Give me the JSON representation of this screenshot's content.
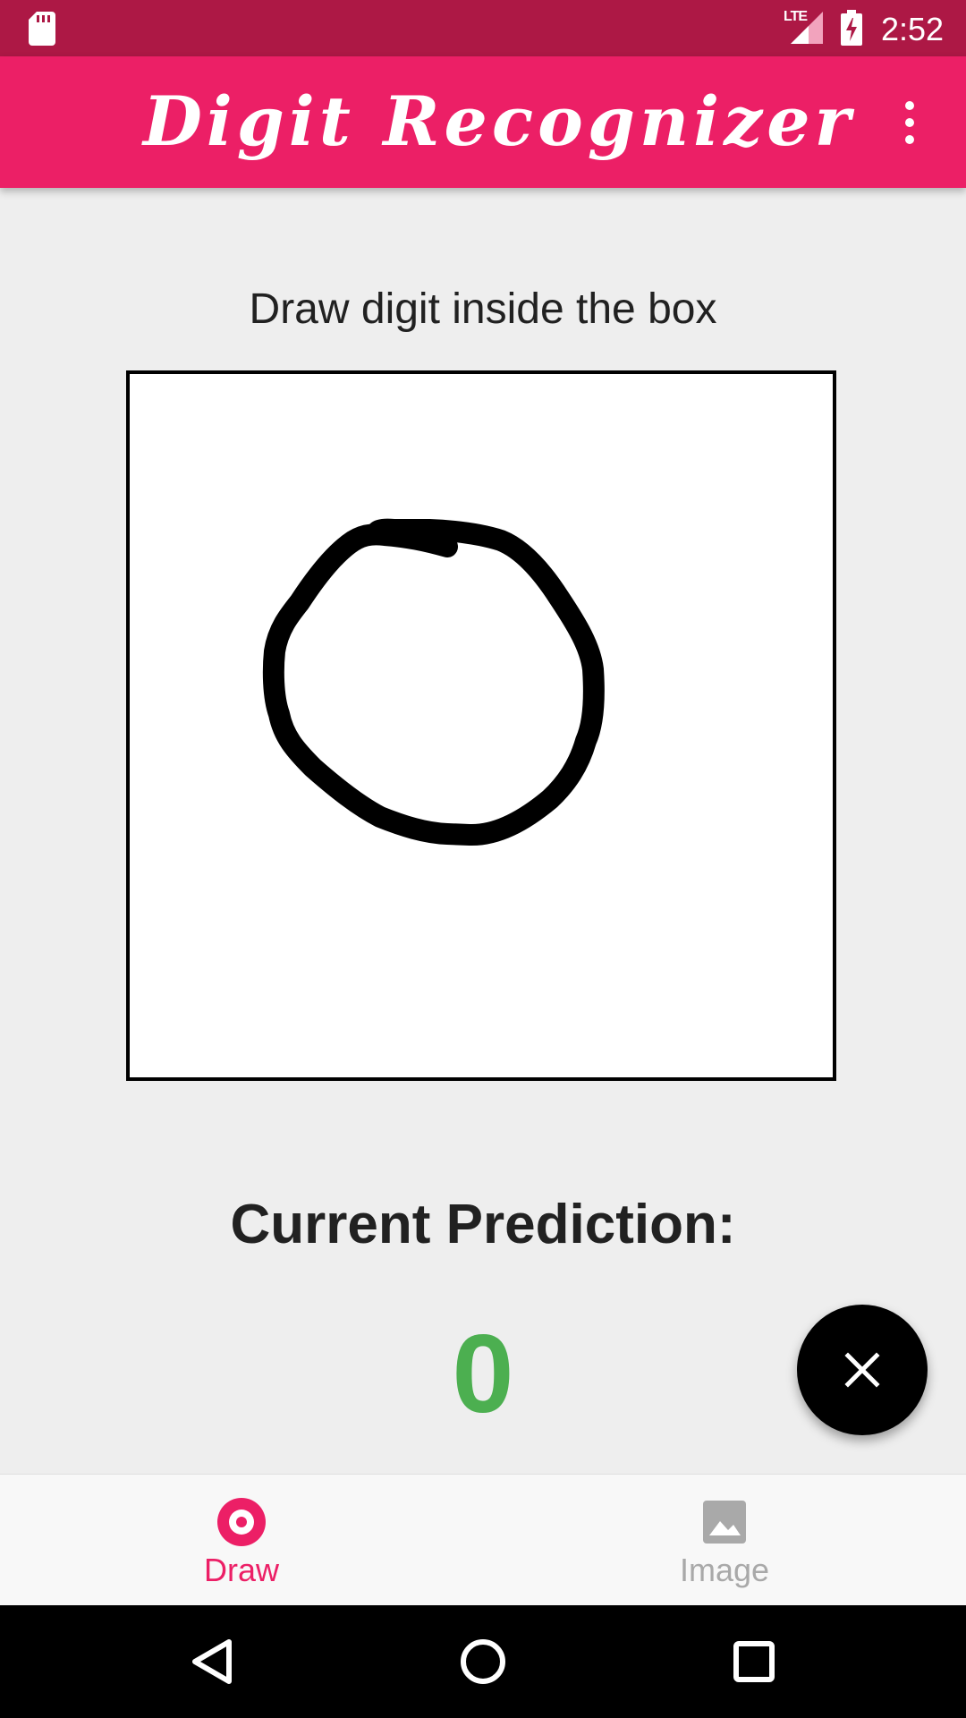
{
  "status_bar": {
    "network_label": "LTE",
    "time": "2:52"
  },
  "app_bar": {
    "title": "Digit Recognizer",
    "menu_icon": "more-vert-icon"
  },
  "main": {
    "instruction": "Draw digit inside the box",
    "prediction_label": "Current Prediction:",
    "prediction_value": "0",
    "prediction_color": "#4caf50"
  },
  "fab": {
    "icon": "close-icon"
  },
  "bottom_nav": {
    "active_color": "#ec1f66",
    "inactive_color": "#a9a9a9",
    "items": [
      {
        "label": "Draw",
        "icon": "draw-target-icon",
        "active": true
      },
      {
        "label": "Image",
        "icon": "image-icon",
        "active": false
      }
    ]
  },
  "system_nav": {
    "buttons": [
      "back-icon",
      "home-icon",
      "recents-icon"
    ]
  },
  "colors": {
    "status_bar": "#ad1845",
    "app_bar": "#ec1f66",
    "background": "#eeeeee"
  }
}
